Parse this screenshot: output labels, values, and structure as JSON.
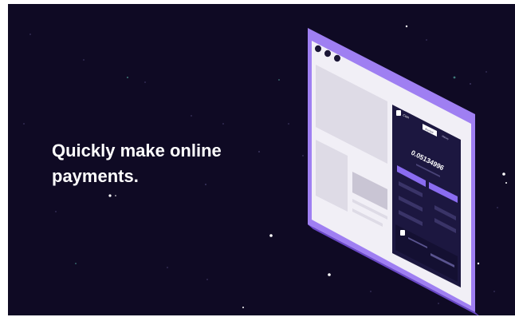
{
  "headline": {
    "line1": "Quickly make online",
    "line2": "payments."
  },
  "wallet": {
    "logo_text": "Coin",
    "active_tab": "Buy/Sell",
    "other_tab": "History",
    "balance": "0.05134996"
  },
  "colors": {
    "background": "#0f0a24",
    "frame": "#9f7ff2",
    "frame_shadow": "#6a48c8",
    "panel": "#1c1740",
    "accent": "#8a6cf0",
    "browser": "#f1eff6"
  },
  "icons": [
    "window-dot-icon",
    "coin-logo-icon"
  ]
}
